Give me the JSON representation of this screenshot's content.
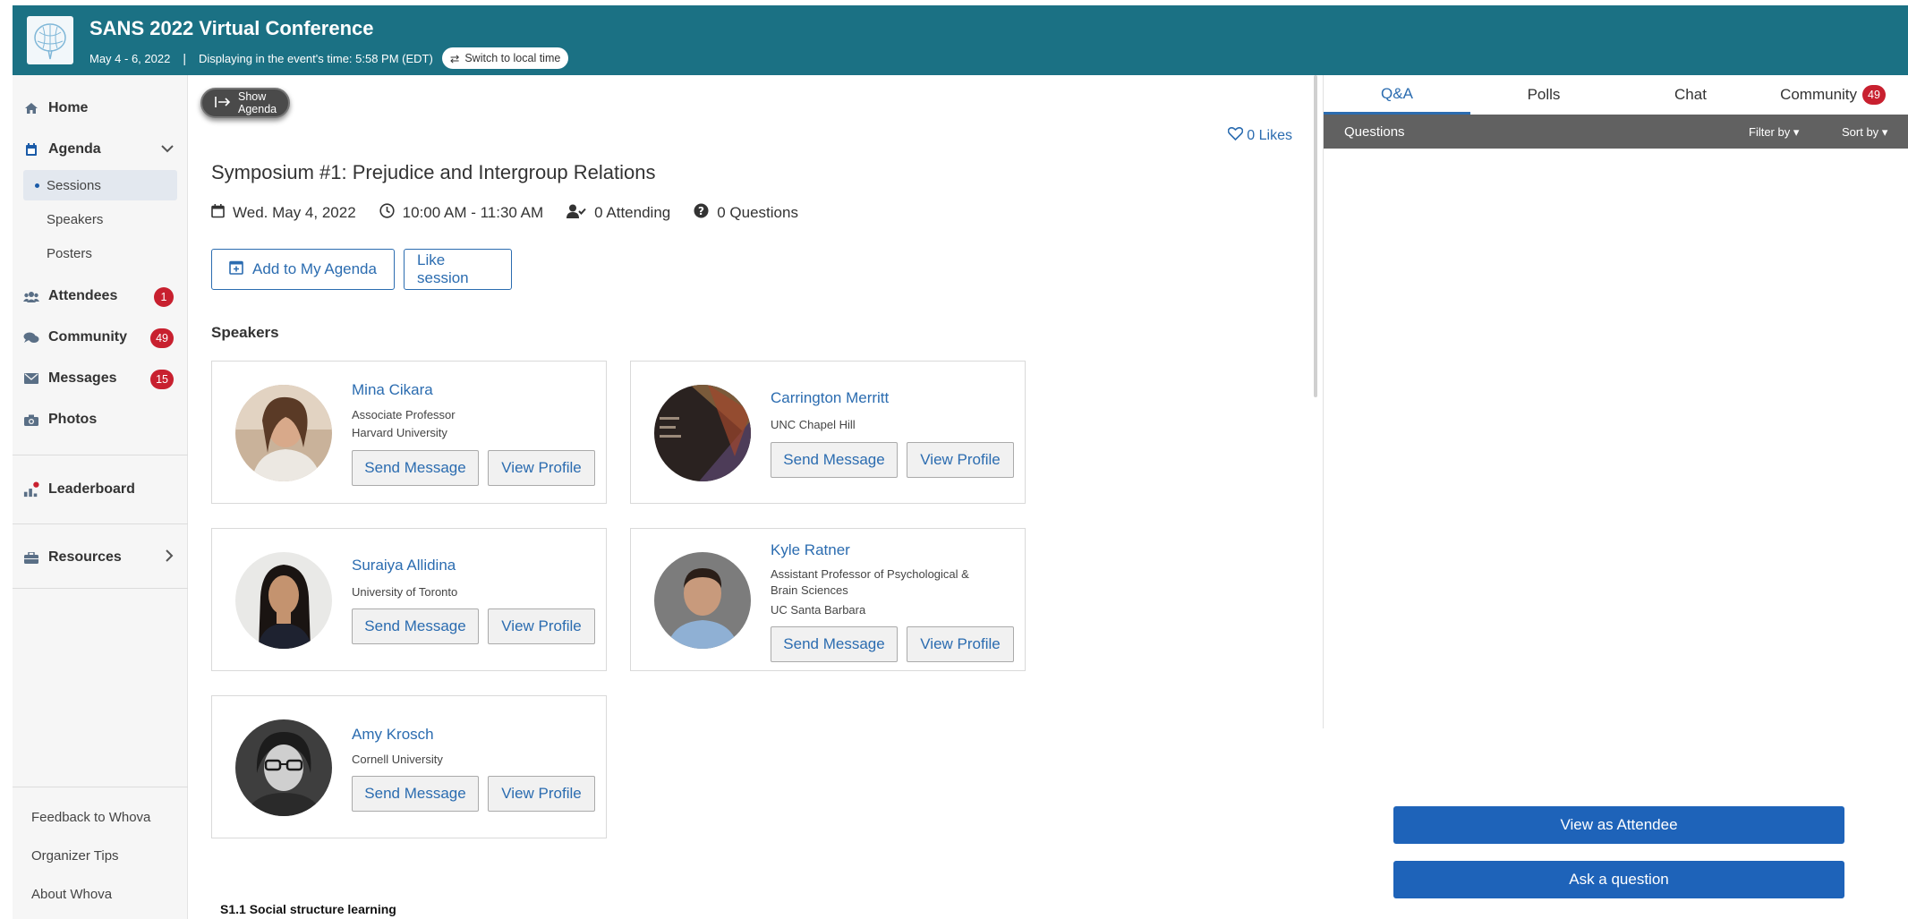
{
  "header": {
    "title": "SANS 2022 Virtual Conference",
    "dates": "May 4 - 6, 2022",
    "separator": "|",
    "timezone_note": "Displaying in the event's time: 5:58 PM (EDT)",
    "local_time_button": "Switch to local time",
    "color": "#1b7184"
  },
  "sidebar": {
    "items": [
      {
        "label": "Home",
        "icon": "home-icon"
      },
      {
        "label": "Agenda",
        "icon": "calendar-icon"
      },
      {
        "label": "Attendees",
        "icon": "users-icon",
        "badge": "1"
      },
      {
        "label": "Community",
        "icon": "comments-icon",
        "badge": "49"
      },
      {
        "label": "Messages",
        "icon": "envelope-icon",
        "badge": "15"
      },
      {
        "label": "Photos",
        "icon": "camera-icon"
      },
      {
        "label": "Leaderboard",
        "icon": "leaderboard-icon"
      },
      {
        "label": "Resources",
        "icon": "briefcase-icon"
      }
    ],
    "agenda_sub": [
      "Sessions",
      "Speakers",
      "Posters"
    ],
    "footer": [
      "Feedback to Whova",
      "Organizer Tips",
      "About Whova"
    ]
  },
  "main": {
    "show_agenda": "Show Agenda",
    "likes": "0 Likes",
    "session_title": "Symposium #1: Prejudice and Intergroup Relations",
    "meta": {
      "date": "Wed. May 4, 2022",
      "time": "10:00 AM - 11:30 AM",
      "attending": "0 Attending",
      "questions": "0 Questions"
    },
    "add_to_agenda": "Add to My Agenda",
    "like_session": "Like session",
    "speakers_heading": "Speakers",
    "send_message": "Send Message",
    "view_profile": "View Profile",
    "speakers": [
      {
        "name": "Mina Cikara",
        "lines": [
          "Associate Professor",
          "Harvard University"
        ]
      },
      {
        "name": "Carrington Merritt",
        "lines": [
          "UNC Chapel Hill"
        ]
      },
      {
        "name": "Suraiya Allidina",
        "lines": [
          "University of Toronto"
        ]
      },
      {
        "name": "Kyle Ratner",
        "lines": [
          "Assistant Professor of Psychological &",
          "Brain Sciences",
          "UC Santa Barbara"
        ]
      },
      {
        "name": "Amy Krosch",
        "lines": [
          "Cornell University"
        ]
      }
    ],
    "subsection": "S1.1 Social structure learning"
  },
  "right_panel": {
    "tabs": [
      "Q&A",
      "Polls",
      "Chat",
      "Community"
    ],
    "community_badge": "49",
    "questions_label": "Questions",
    "filter_by": "Filter by",
    "sort_by": "Sort by",
    "view_as_attendee": "View as Attendee",
    "ask_question": "Ask a question",
    "accent": "#1e63b9"
  }
}
